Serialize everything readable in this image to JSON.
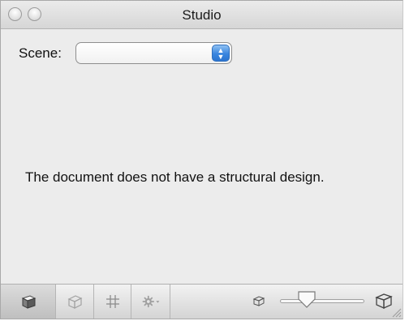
{
  "window": {
    "title": "Studio"
  },
  "scene": {
    "label": "Scene:",
    "selected_value": ""
  },
  "message": "The document does not have a structural design.",
  "toolbar": {
    "buttons": [
      {
        "icon": "render-view-icon",
        "active": true
      },
      {
        "icon": "box-view-icon",
        "active": false
      },
      {
        "icon": "grid-icon",
        "active": false
      },
      {
        "icon": "gear-menu-icon",
        "active": false
      }
    ],
    "zoom": {
      "level": 0.25
    }
  },
  "colors": {
    "accent": "#3a86df"
  }
}
